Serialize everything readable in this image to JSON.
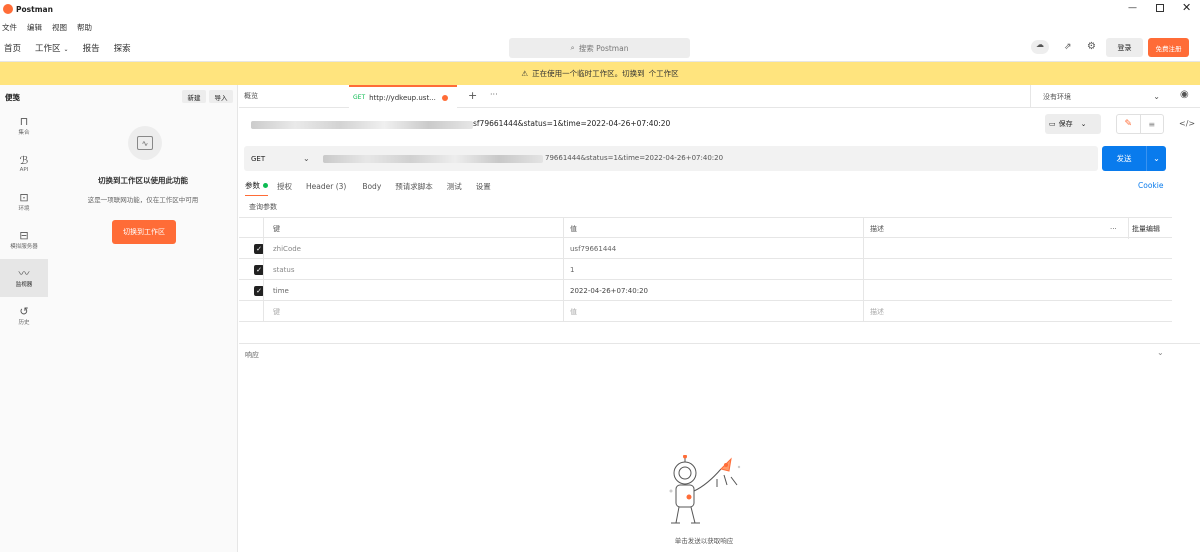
{
  "window": {
    "title": "Postman"
  },
  "menu": [
    "文件",
    "编辑",
    "视图",
    "帮助"
  ],
  "topnav": {
    "home": "首页",
    "workspace": "工作区",
    "reports": "报告",
    "explore": "探索",
    "search_placeholder": "搜索 Postman",
    "login": "登录",
    "register": "免费注册"
  },
  "banner": {
    "text": "正在使用一个临时工作区。切换到",
    "link": "个工作区"
  },
  "sidebar": {
    "title": "便笺",
    "new_label": "新建",
    "import_label": "导入",
    "rail": [
      {
        "label": "集合",
        "icon": "collection-icon"
      },
      {
        "label": "API",
        "icon": "api-icon"
      },
      {
        "label": "环境",
        "icon": "environment-icon"
      },
      {
        "label": "模拟服务器",
        "icon": "mock-server-icon"
      },
      {
        "label": "监视器",
        "icon": "monitor-icon",
        "active": true
      },
      {
        "label": "历史",
        "icon": "history-icon"
      }
    ],
    "empty_title": "切换到工作区以使用此功能",
    "empty_desc": "这是一项联网功能，仅在工作区中可用",
    "empty_button": "切换到工作区"
  },
  "tabs": {
    "overview": "概览",
    "active_method": "GET",
    "active_name": "http://ydkeup.ust...",
    "environment": "没有环境"
  },
  "request": {
    "title_suffix": "sf79661444&status=1&time=2022-04-26+07:40:20",
    "save_label": "保存",
    "method": "GET",
    "url_suffix": "79661444&status=1&time=2022-04-26+07:40:20",
    "send_label": "发送",
    "cookie_label": "Cookie",
    "subtabs": [
      "参数",
      "授权",
      "Header (3)",
      "Body",
      "预请求脚本",
      "测试",
      "设置"
    ],
    "query_label": "查询参数"
  },
  "params": {
    "headers": {
      "key": "键",
      "value": "值",
      "description": "描述",
      "bulk": "批量编辑"
    },
    "rows": [
      {
        "key": "zhiCode",
        "value": "usf79661444"
      },
      {
        "key": "status",
        "value": "1"
      },
      {
        "key": "time",
        "value": "2022-04-26+07:40:20"
      }
    ],
    "placeholder": {
      "key": "键",
      "value": "值",
      "description": "描述"
    }
  },
  "response": {
    "label": "响应",
    "empty_text": "单击发送以获取响应"
  },
  "colors": {
    "accent": "#ff6c37",
    "send": "#097bed",
    "banner": "#ffe47e",
    "active_dot": "#0cbb52"
  }
}
